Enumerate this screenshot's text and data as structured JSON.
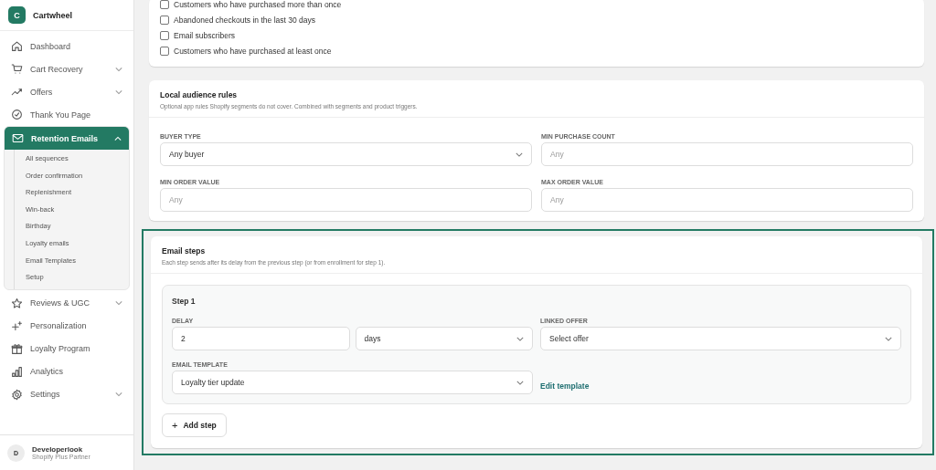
{
  "sidebar": {
    "brand": {
      "initial": "C",
      "name": "Cartwheel"
    },
    "items": [
      {
        "label": "Dashboard",
        "selected": false
      },
      {
        "label": "Cart Recovery",
        "selected": false,
        "expanded": false
      },
      {
        "label": "Offers",
        "selected": false,
        "expanded": false
      },
      {
        "label": "Thank You Page",
        "selected": false
      },
      {
        "label": "Retention Emails",
        "selected": true,
        "expanded": true,
        "children": [
          {
            "label": "All sequences"
          },
          {
            "label": "Order confirmation"
          },
          {
            "label": "Replenishment"
          },
          {
            "label": "Win-back"
          },
          {
            "label": "Birthday"
          },
          {
            "label": "Loyalty emails"
          },
          {
            "label": "Email Templates"
          },
          {
            "label": "Setup"
          }
        ]
      },
      {
        "label": "Reviews & UGC",
        "selected": false,
        "expanded": false
      },
      {
        "label": "Personalization",
        "selected": false
      },
      {
        "label": "Loyalty Program",
        "selected": false
      },
      {
        "label": "Analytics",
        "selected": false
      },
      {
        "label": "Settings",
        "selected": false,
        "expanded": false
      }
    ],
    "user": {
      "initial": "D",
      "name": "Developerlook",
      "role": "Shopify Plus Partner"
    }
  },
  "segments_card": {
    "options": [
      {
        "label": "Customers who have purchased more than once",
        "checked": false
      },
      {
        "label": "Abandoned checkouts in the last 30 days",
        "checked": false
      },
      {
        "label": "Email subscribers",
        "checked": false
      },
      {
        "label": "Customers who have purchased at least once",
        "checked": false
      }
    ]
  },
  "audience_card": {
    "title": "Local audience rules",
    "subtitle": "Optional app rules Shopify segments do not cover. Combined with segments and product triggers.",
    "fields": [
      {
        "label": "BUYER TYPE",
        "kind": "select",
        "value": "Any buyer"
      },
      {
        "label": "MIN PURCHASE COUNT",
        "kind": "input",
        "placeholder": "Any"
      },
      {
        "label": "MIN ORDER VALUE",
        "kind": "input",
        "placeholder": "Any"
      },
      {
        "label": "MAX ORDER VALUE",
        "kind": "input",
        "placeholder": "Any"
      }
    ]
  },
  "steps_card": {
    "highlighted": true,
    "title": "Email steps",
    "subtitle": "Each step sends after its delay from the previous step (or from enrollment for step 1).",
    "steps": [
      {
        "title": "Step 1",
        "delay_label": "DELAY",
        "delay_value": "2",
        "delay_unit": "days",
        "offer_label": "LINKED OFFER",
        "offer_value": "Select offer",
        "template_label": "EMAIL TEMPLATE",
        "template_value": "Loyalty tier update",
        "edit_link": "Edit template"
      }
    ],
    "add_button": {
      "icon": "+",
      "label": "Add step"
    }
  }
}
